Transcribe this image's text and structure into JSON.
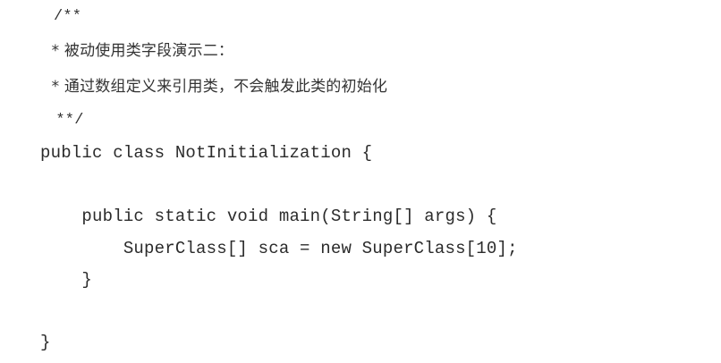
{
  "code_lines": [
    "/**",
    " * 被动使用类字段演示二：",
    " * 通过数组定义来引用类，不会触发此类的初始化",
    " **/",
    "public class NotInitialization {",
    "",
    "    public static void main(String[] args) {",
    "        SuperClass[] sca = new SuperClass[10];",
    "    }",
    "",
    "}"
  ]
}
